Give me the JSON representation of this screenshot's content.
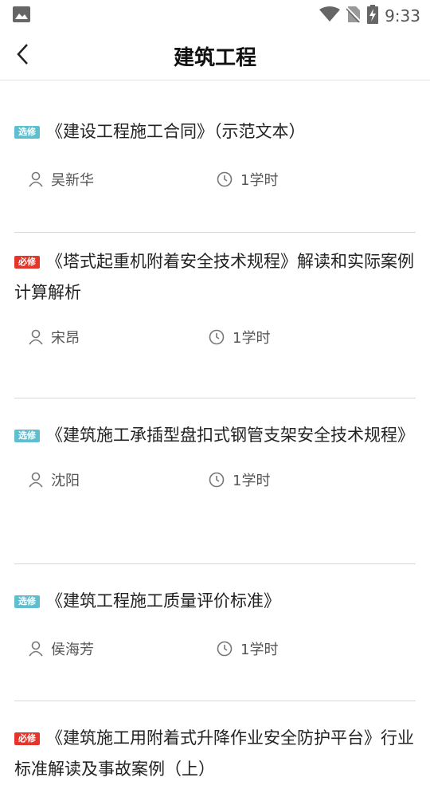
{
  "status": {
    "time": "9:33"
  },
  "nav": {
    "title": "建筑工程"
  },
  "courses": [
    {
      "badge": "选修",
      "badge_type": "elective",
      "title": "《建设工程施工合同》（示范文本）",
      "teacher": "吴新华",
      "hours": "1学时"
    },
    {
      "badge": "必修",
      "badge_type": "required",
      "title": "《塔式起重机附着安全技术规程》解读和实际案例计算解析",
      "teacher": "宋昂",
      "hours": "1学时"
    },
    {
      "badge": "选修",
      "badge_type": "elective",
      "title": "《建筑施工承插型盘扣式钢管支架安全技术规程》",
      "teacher": "沈阳",
      "hours": "1学时"
    },
    {
      "badge": "选修",
      "badge_type": "elective",
      "title": "《建筑工程施工质量评价标准》",
      "teacher": "侯海芳",
      "hours": "1学时"
    },
    {
      "badge": "必修",
      "badge_type": "required",
      "title": "《建筑施工用附着式升降作业安全防护平台》行业标准解读及事故案例（上）",
      "teacher": "",
      "hours": ""
    }
  ],
  "colors": {
    "elective": "#5dbfcf",
    "required": "#e5352b"
  }
}
